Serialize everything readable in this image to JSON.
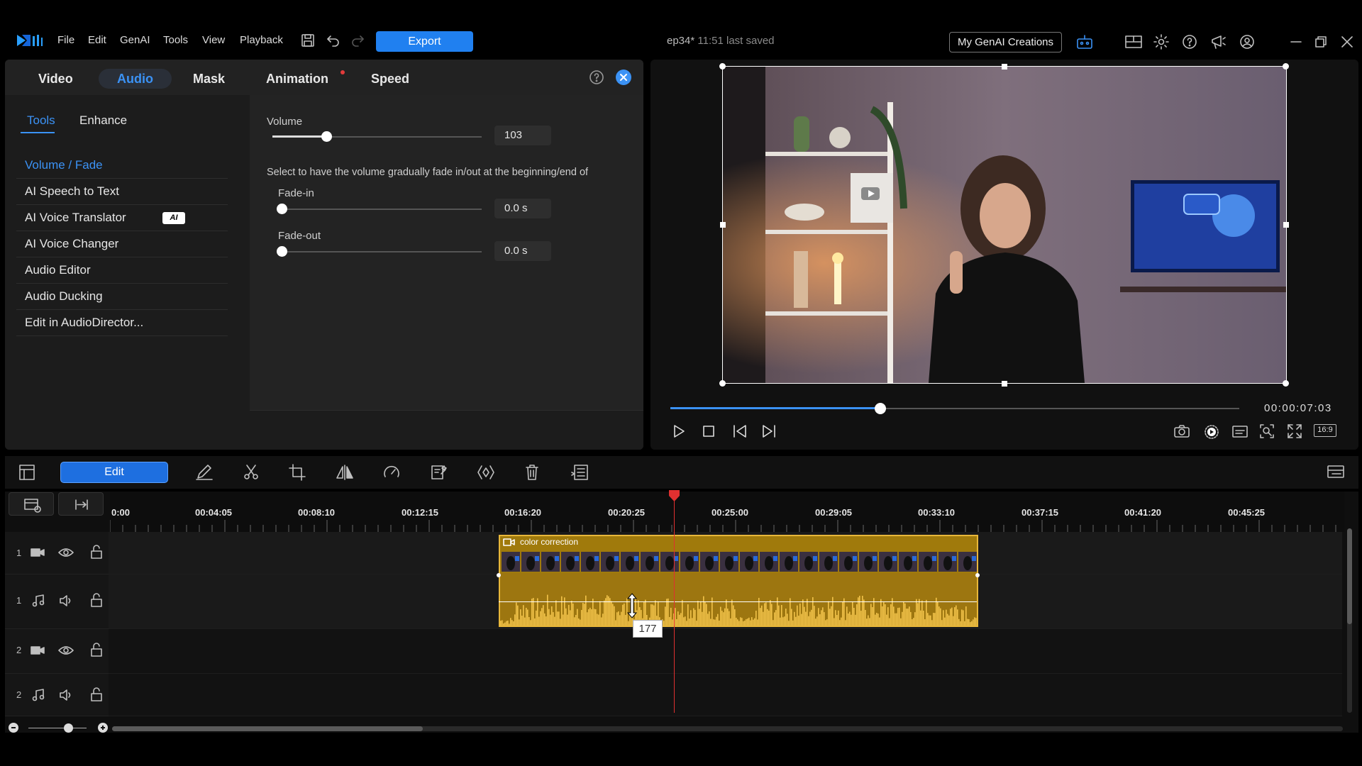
{
  "app": {
    "menu": [
      "File",
      "Edit",
      "GenAI",
      "Tools",
      "View",
      "Playback"
    ],
    "export_label": "Export",
    "project_name": "ep34*",
    "last_saved": "11:51 last saved",
    "genai_creations_label": "My GenAI Creations"
  },
  "panel": {
    "tabs": [
      "Video",
      "Audio",
      "Mask",
      "Animation",
      "Speed"
    ],
    "active_tab": "Audio",
    "subtabs": [
      "Tools",
      "Enhance"
    ],
    "tools": [
      "Volume / Fade",
      "AI Speech to Text",
      "AI Voice Translator",
      "AI Voice Changer",
      "Audio Editor",
      "Audio Ducking",
      "Edit in AudioDirector..."
    ],
    "ai_badge": "AI",
    "volume_label": "Volume",
    "volume_value": "103",
    "volume_level": 0.26,
    "fade_description": "Select to have the volume gradually fade in/out at the beginning/end of",
    "fadein_label": "Fade-in",
    "fadein_value": "0.0 s",
    "fadeout_label": "Fade-out",
    "fadeout_value": "0.0 s"
  },
  "preview": {
    "timecode": "00:00:07:03",
    "progress": 0.37,
    "aspect_label": "16:9"
  },
  "timeline": {
    "edit_label": "Edit",
    "ruler": [
      "0:00",
      "00:04:05",
      "00:08:10",
      "00:12:15",
      "00:16:20",
      "00:20:25",
      "00:25:00",
      "00:29:05",
      "00:33:10",
      "00:37:15",
      "00:41:20",
      "00:45:25"
    ],
    "tracks": [
      {
        "num": "1",
        "type": "video"
      },
      {
        "num": "1",
        "type": "audio"
      },
      {
        "num": "2",
        "type": "video"
      },
      {
        "num": "2",
        "type": "audio"
      }
    ],
    "clip_label": "color correction",
    "volume_tooltip": "177"
  },
  "colors": {
    "accent": "#2080f0",
    "clip": "#a07a0c",
    "waveform": "#f2c34a",
    "playhead": "#e03030"
  }
}
